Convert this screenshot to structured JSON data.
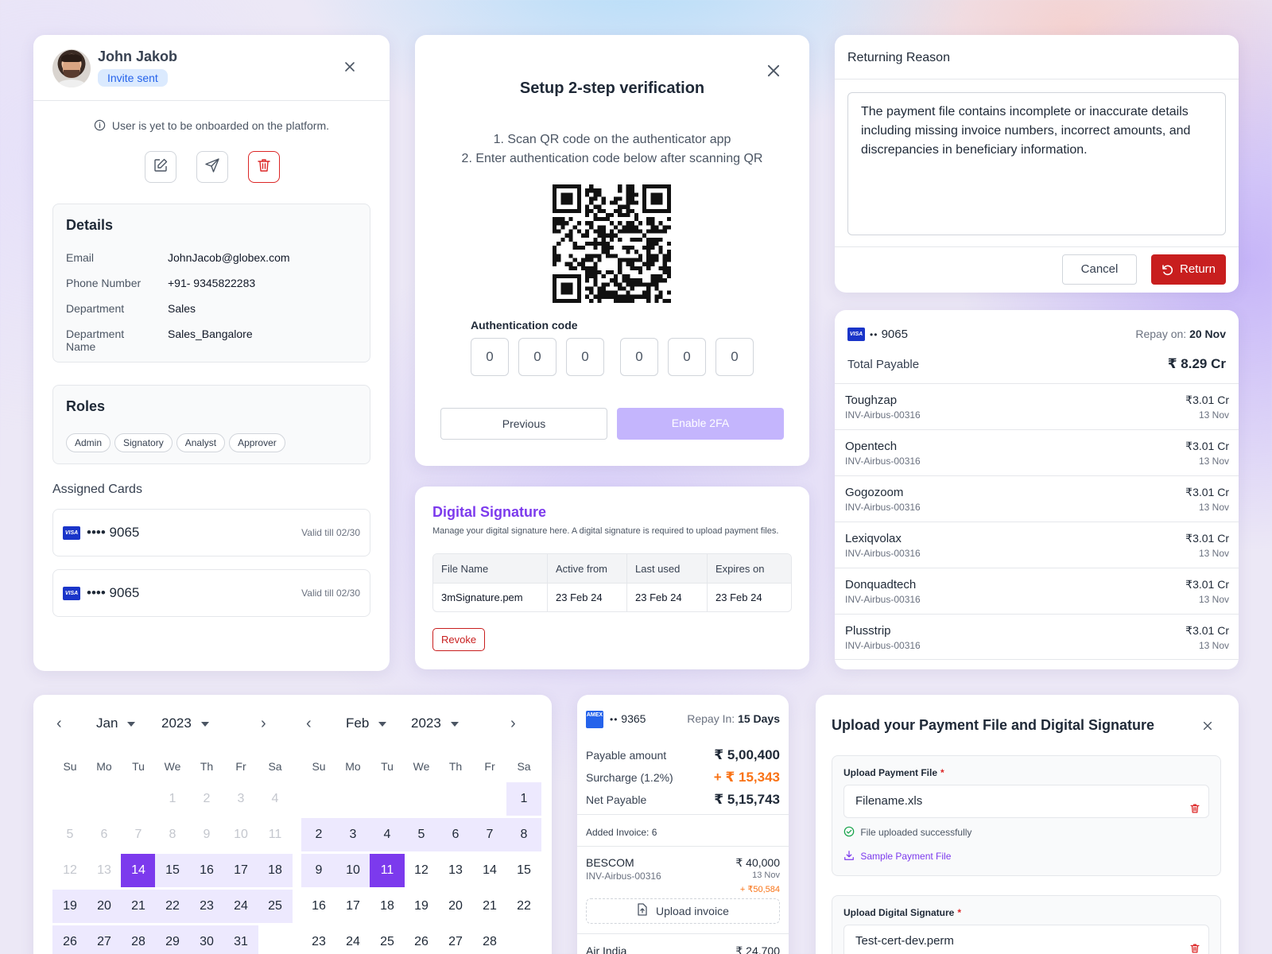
{
  "profile": {
    "name": "John Jakob",
    "badge": "Invite sent",
    "notice": "User is yet to be onboarded on the platform.",
    "details_title": "Details",
    "details": [
      {
        "label": "Email",
        "value": "JohnJacob@globex.com"
      },
      {
        "label": "Phone Number",
        "value": "+91- 9345822283"
      },
      {
        "label": "Department",
        "value": "Sales"
      },
      {
        "label": "Department Name",
        "value": "Sales_Bangalore"
      }
    ],
    "roles_title": "Roles",
    "roles": [
      "Admin",
      "Signatory",
      "Analyst",
      "Approver"
    ],
    "assigned_title": "Assigned Cards",
    "cards": [
      {
        "brand": "VISA",
        "masked": "•••• 9065",
        "valid": "Valid till 02/30"
      },
      {
        "brand": "VISA",
        "masked": "•••• 9065",
        "valid": "Valid till 02/30"
      }
    ]
  },
  "twofa": {
    "title": "Setup 2-step verification",
    "step1": "1. Scan QR code on the authenticator app",
    "step2": "2. Enter authentication code below after scanning QR",
    "code_label": "Authentication code",
    "digits": [
      "0",
      "0",
      "0",
      "0",
      "0",
      "0"
    ],
    "previous": "Previous",
    "enable": "Enable 2FA"
  },
  "returning": {
    "title": "Returning Reason",
    "text": "The payment file contains incomplete or inaccurate details including missing invoice numbers, incorrect amounts, and discrepancies in beneficiary information.",
    "cancel": "Cancel",
    "return": "Return"
  },
  "repay_card": {
    "brand": "VISA",
    "dots": "••",
    "number": "9065",
    "repay_label": "Repay on:",
    "repay_date": "20 Nov",
    "total_label": "Total Payable",
    "total_value": "₹ 8.29 Cr",
    "rows": [
      {
        "name": "Toughzap",
        "sub": "INV-Airbus-00316",
        "amount": "₹3.01 Cr",
        "date": "13 Nov"
      },
      {
        "name": "Opentech",
        "sub": "INV-Airbus-00316",
        "amount": "₹3.01 Cr",
        "date": "13 Nov"
      },
      {
        "name": "Gogozoom",
        "sub": "INV-Airbus-00316",
        "amount": "₹3.01 Cr",
        "date": "13 Nov"
      },
      {
        "name": "Lexiqvolax",
        "sub": "INV-Airbus-00316",
        "amount": "₹3.01 Cr",
        "date": "13 Nov"
      },
      {
        "name": "Donquadtech",
        "sub": "INV-Airbus-00316",
        "amount": "₹3.01 Cr",
        "date": "13 Nov"
      },
      {
        "name": "Plusstrip",
        "sub": "INV-Airbus-00316",
        "amount": "₹3.01 Cr",
        "date": "13 Nov"
      }
    ]
  },
  "signature": {
    "title": "Digital Signature",
    "subtitle": "Manage your digital signature here. A digital signature is required to upload payment files.",
    "columns": [
      "File Name",
      "Active from",
      "Last used",
      "Expires on"
    ],
    "row": [
      "3mSignature.pem",
      "23 Feb 24",
      "23 Feb 24",
      "23 Feb 24"
    ],
    "revoke": "Revoke"
  },
  "calendar": {
    "weekdays": [
      "Su",
      "Mo",
      "Tu",
      "We",
      "Th",
      "Fr",
      "Sa"
    ],
    "left": {
      "month": "Jan",
      "year": "2023",
      "weeks": [
        [
          "",
          "",
          "",
          "1",
          "2",
          "3",
          "4"
        ],
        [
          "5",
          "6",
          "7",
          "8",
          "9",
          "10",
          "11"
        ],
        [
          "12",
          "13",
          "14",
          "15",
          "16",
          "17",
          "18"
        ],
        [
          "19",
          "20",
          "21",
          "22",
          "23",
          "24",
          "25"
        ],
        [
          "26",
          "27",
          "28",
          "29",
          "30",
          "31",
          ""
        ]
      ]
    },
    "right": {
      "month": "Feb",
      "year": "2023",
      "weeks": [
        [
          "",
          "",
          "",
          "",
          "",
          "",
          "1"
        ],
        [
          "2",
          "3",
          "4",
          "5",
          "6",
          "7",
          "8"
        ],
        [
          "9",
          "10",
          "11",
          "12",
          "13",
          "14",
          "15"
        ],
        [
          "16",
          "17",
          "18",
          "19",
          "20",
          "21",
          "22"
        ],
        [
          "23",
          "24",
          "25",
          "26",
          "27",
          "28",
          ""
        ]
      ]
    },
    "range_start": "Jan 14",
    "range_end": "Feb 11",
    "colors": {
      "selected": "#7c3aed",
      "range": "#ede9fe"
    }
  },
  "amex_card": {
    "brand": "AMEX",
    "dots": "••",
    "number": "9365",
    "repay_label": "Repay In:",
    "repay_value": "15 Days",
    "payable_label": "Payable amount",
    "payable_value": "₹ 5,00,400",
    "surcharge_label": "Surcharge (1.2%)",
    "surcharge_value": "+ ₹ 15,343",
    "net_label": "Net Payable",
    "net_value": "₹ 5,15,743",
    "added": "Added Invoice: 6",
    "inv1": {
      "name": "BESCOM",
      "sub": "INV-Airbus-00316",
      "amount": "₹ 40,000",
      "date": "13 Nov",
      "extra": "+ ₹50,584"
    },
    "upload": "Upload invoice",
    "inv2": {
      "name": "Air India",
      "amount": "₹ 24,700"
    }
  },
  "upload": {
    "title": "Upload your Payment File and Digital Signature",
    "payment_label": "Upload Payment File",
    "payment_file": "Filename.xls",
    "success": "File uploaded successfully",
    "sample": "Sample Payment File",
    "signature_label": "Upload Digital Signature",
    "signature_file": "Test-cert-dev.perm",
    "required": "*"
  }
}
